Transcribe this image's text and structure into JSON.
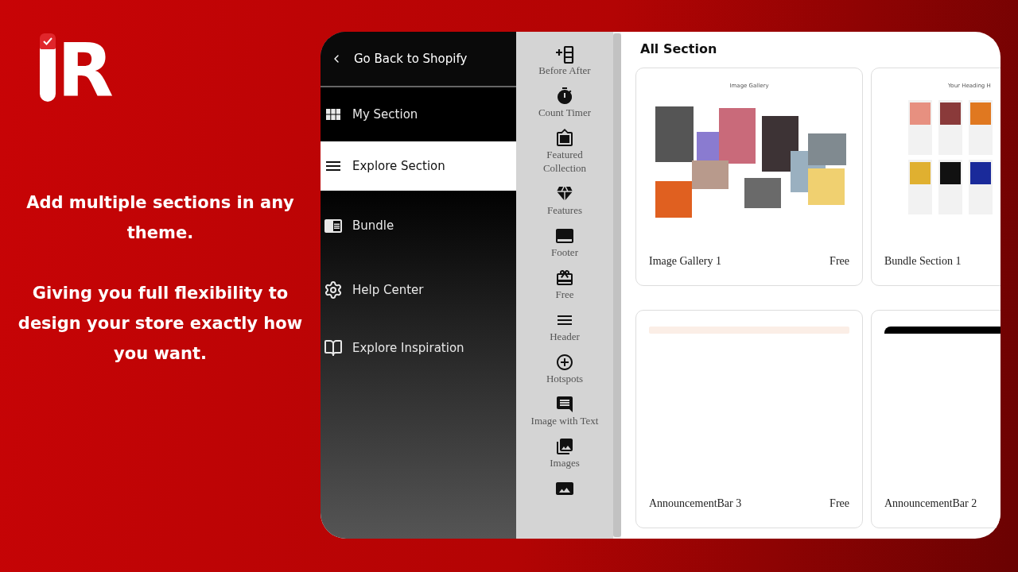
{
  "logo": {
    "text": "R"
  },
  "taglines": [
    "Add multiple sections in any theme.",
    "Giving you full flexibility to design your store exactly how you want."
  ],
  "nav": {
    "back": "Go Back to Shopify",
    "items": [
      {
        "label": "My Section",
        "selected": false
      },
      {
        "label": "Explore Section",
        "selected": true
      },
      {
        "label": "Bundle",
        "selected": false
      },
      {
        "label": "Help Center",
        "selected": false
      },
      {
        "label": "Explore Inspiration",
        "selected": false
      }
    ]
  },
  "categories": [
    {
      "label": "Before After"
    },
    {
      "label": "Count Timer"
    },
    {
      "label": "Featured Collection"
    },
    {
      "label": "Features"
    },
    {
      "label": "Footer"
    },
    {
      "label": "Free"
    },
    {
      "label": "Header"
    },
    {
      "label": "Hotspots"
    },
    {
      "label": "Image with Text"
    },
    {
      "label": "Images"
    }
  ],
  "main": {
    "title": "All Section",
    "cards": [
      {
        "kind": "gallery",
        "preview_title": "Image Gallery",
        "name": "Image Gallery 1",
        "price": "Free"
      },
      {
        "kind": "bundle",
        "preview_title": "Your Heading H",
        "name": "Bundle Section 1"
      },
      {
        "kind": "announcement-light",
        "name": "AnnouncementBar 3",
        "price": "Free"
      },
      {
        "kind": "announcement-dark",
        "name": "AnnouncementBar 2"
      }
    ]
  }
}
